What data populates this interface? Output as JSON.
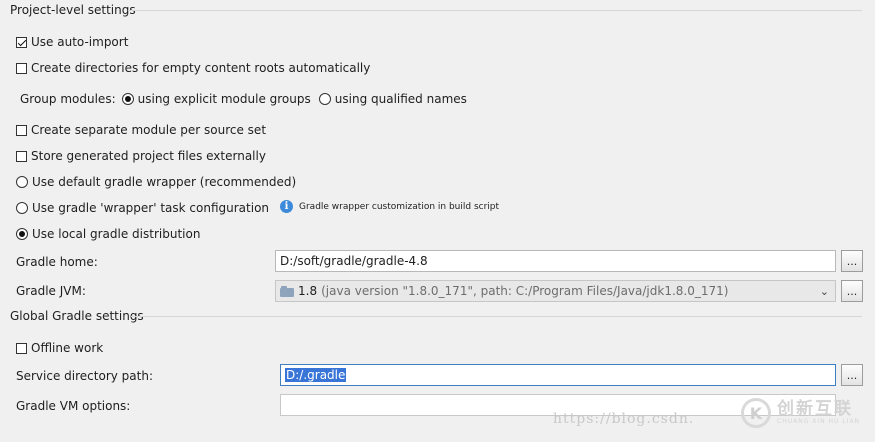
{
  "project_section": {
    "title": "Project-level settings",
    "use_auto_import": {
      "label": "Use auto-import",
      "checked": true
    },
    "create_dirs": {
      "label": "Create directories for empty content roots automatically",
      "checked": false
    },
    "group_modules": {
      "label": "Group modules:",
      "explicit": {
        "label": "using explicit module groups",
        "selected": true
      },
      "qualified": {
        "label": "using qualified names",
        "selected": false
      }
    },
    "separate_module": {
      "label": "Create separate module per source set",
      "checked": false
    },
    "store_external": {
      "label": "Store generated project files externally",
      "checked": false
    },
    "wrapper_default": {
      "label": "Use default gradle wrapper (recommended)",
      "selected": false
    },
    "wrapper_task": {
      "label": "Use gradle 'wrapper' task configuration",
      "selected": false
    },
    "wrapper_info": "Gradle wrapper customization in build script",
    "local_distribution": {
      "label": "Use local gradle distribution",
      "selected": true
    },
    "gradle_home": {
      "label": "Gradle home:",
      "value": "D:/soft/gradle/gradle-4.8",
      "browse": "..."
    },
    "gradle_jvm": {
      "label": "Gradle JVM:",
      "version": "1.8",
      "detail": "(java version \"1.8.0_171\", path: C:/Program Files/Java/jdk1.8.0_171)",
      "browse": "..."
    }
  },
  "global_section": {
    "title": "Global Gradle settings",
    "offline": {
      "label": "Offline work",
      "checked": false
    },
    "service_dir": {
      "label": "Service directory path:",
      "value": "D:/.gradle",
      "browse": "..."
    },
    "vm_options": {
      "label": "Gradle VM options:",
      "value": ""
    }
  },
  "watermark": {
    "url": "https://blog.csdn.",
    "brand": "创新互联",
    "brand_sub": "CHUANG XIN HU LIAN",
    "logo_letter": "K"
  },
  "icons": {
    "info": "i",
    "dropdown": "⌄"
  }
}
